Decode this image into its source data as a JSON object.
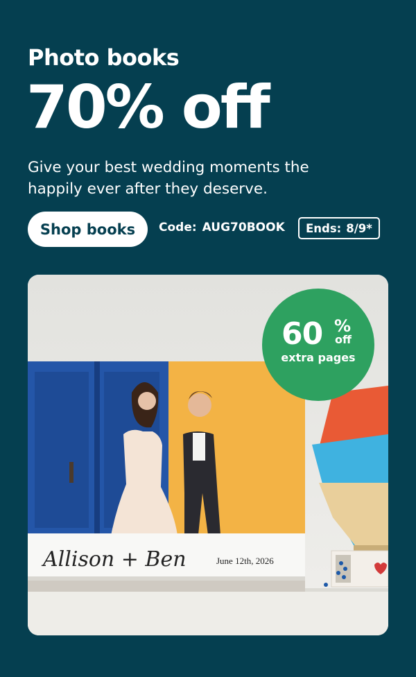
{
  "promo": {
    "eyebrow": "Photo books",
    "headline": "70% off",
    "subtext": "Give your best wedding moments the happily ever after they deserve.",
    "cta_label": "Shop books",
    "code_label": "Code:",
    "code_value": "AUG70BOOK",
    "ends_label": "Ends:",
    "ends_value": "8/9*"
  },
  "badge": {
    "value": "60",
    "percent": "%",
    "off": "off",
    "caption": "extra pages"
  },
  "book": {
    "names": "Allison + Ben",
    "date": "June 12th, 2026"
  },
  "colors": {
    "background": "#053f50",
    "badge": "#2ea160"
  }
}
